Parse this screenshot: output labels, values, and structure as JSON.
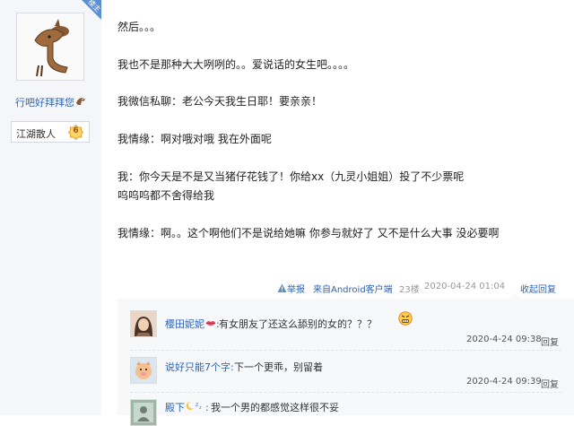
{
  "author": {
    "floor_tag": "楼主",
    "name": "行吧好拜拜您",
    "name_icon": "horse-emoji-icon",
    "rank_title": "江湖散人",
    "rank_level": "6"
  },
  "post": {
    "lines": [
      "然后。。。",
      "我也不是那种大大咧咧的。。爱说话的女生吧。。。。",
      "我微信私聊：老公今天我生日耶！要亲亲！",
      "我情缘：啊对哦对哦 我在外面呢",
      "我：你今天是不是又当猪仔花钱了！你给xx（九灵小姐姐）投了不少票呢",
      "呜呜呜都不舍得给我",
      "我情缘：啊。。这个啊他们不是说给她嘛 你参与就好了 又不是什么大事 没必要啊"
    ],
    "tail": {
      "report": "举报",
      "source": "来自Android客户端",
      "floor": "23楼",
      "time": "2020-04-24 01:04",
      "fold_reply": "收起回复"
    }
  },
  "replies": [
    {
      "name": "樱田妮妮",
      "name_icon": "lips-icon",
      "text": "有女朋友了还这么舔别的女的？？？",
      "emoji": "angry-face-icon",
      "time": "2020-4-24 09:38",
      "reply_label": "回复"
    },
    {
      "name": "说好只能7个字",
      "text": "下一个更乖，别留着",
      "time": "2020-4-24 09:39",
      "reply_label": "回复"
    },
    {
      "name": "殿下",
      "name_icon": "moon-zzz-icon",
      "text": "我一个男的都感觉这样很不妥"
    }
  ],
  "colors": {
    "link": "#2d64b3",
    "sidebar_bg": "#f4f6f9",
    "reply_bg": "#f7f8fa",
    "floor_tag_bg": "#5b8fd4"
  }
}
